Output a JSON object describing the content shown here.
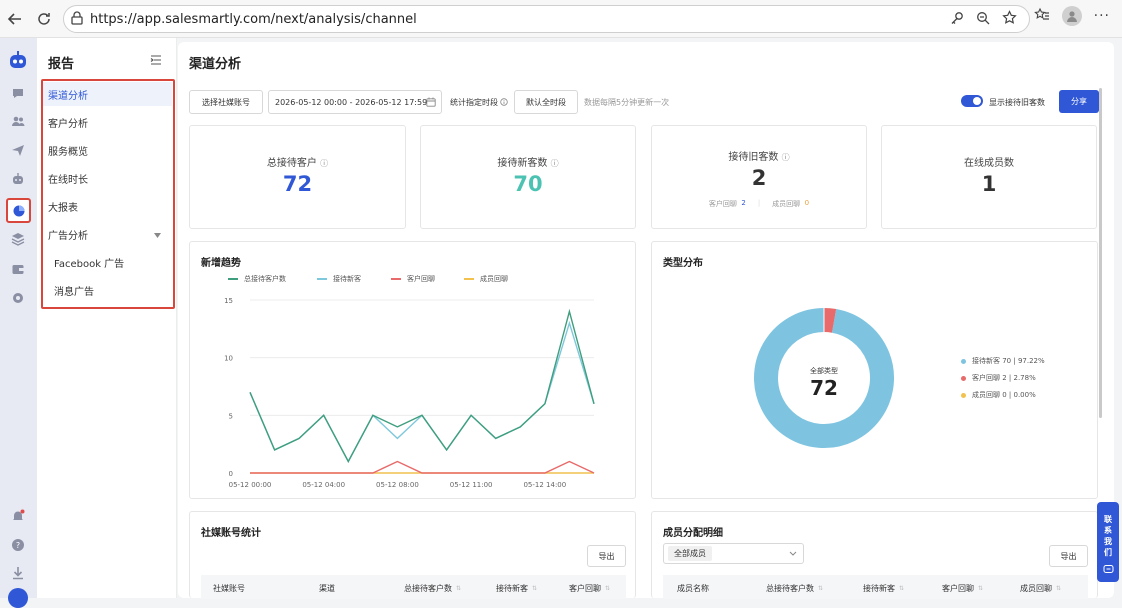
{
  "browser": {
    "url": "https://app.salesmartly.com/next/analysis/channel"
  },
  "sidebar": {
    "title": "报告",
    "items": [
      {
        "label": "渠道分析",
        "active": true
      },
      {
        "label": "客户分析"
      },
      {
        "label": "服务概览"
      },
      {
        "label": "在线时长"
      },
      {
        "label": "大报表"
      },
      {
        "label": "广告分析",
        "expandable": true
      },
      {
        "label": "Facebook 广告",
        "sub": true
      },
      {
        "label": "消息广告",
        "sub": true
      }
    ]
  },
  "toolbar": {
    "page_title": "渠道分析",
    "select_account_label": "选择社媒账号",
    "date_range": "2026-05-12 00:00 - 2026-05-12 17:59",
    "stat_period_label": "统计指定时段",
    "default_period_label": "默认全时段",
    "update_note": "数据每隔5分钟更新一次",
    "toggle_label": "显示接待旧客数",
    "share_label": "分享"
  },
  "stats": [
    {
      "label": "总接待客户",
      "value": "72",
      "color": "#2f57d6",
      "info": true
    },
    {
      "label": "接待新客数",
      "value": "70",
      "color": "#4cc2b2",
      "info": true
    },
    {
      "label": "接待旧客数",
      "value": "2",
      "color": "#333333",
      "info": true,
      "sub": [
        {
          "label": "客户回聊",
          "value": "2",
          "color": "#2f57d6"
        },
        {
          "label": "成员回聊",
          "value": "0",
          "color": "#e6a23c"
        }
      ]
    },
    {
      "label": "在线成员数",
      "value": "1",
      "color": "#333333",
      "info": false
    }
  ],
  "trend": {
    "title": "新增趋势"
  },
  "distribution": {
    "title": "类型分布",
    "center_label": "全部类型",
    "center_value": "72"
  },
  "social_stats": {
    "title": "社媒账号统计",
    "export_label": "导出",
    "columns": [
      "社媒账号",
      "渠道",
      "总接待客户数",
      "接待新客",
      "客户回聊"
    ]
  },
  "member_detail": {
    "title": "成员分配明细",
    "filter_value": "全部成员",
    "export_label": "导出",
    "columns": [
      "成员名称",
      "总接待客户数",
      "接待新客",
      "客户回聊",
      "成员回聊"
    ]
  },
  "contact_tab": {
    "chars": [
      "联",
      "系",
      "我",
      "们"
    ]
  },
  "chart_data": [
    {
      "type": "line",
      "title": "新增趋势",
      "x": [
        "05-12 00:00",
        "05-12 01:00",
        "05-12 02:00",
        "05-12 03:00",
        "05-12 04:00",
        "05-12 05:00",
        "05-12 06:00",
        "05-12 07:00",
        "05-12 08:00",
        "05-12 09:00",
        "05-12 10:00",
        "05-12 11:00",
        "05-12 12:00",
        "05-12 13:00",
        "05-12 14:00",
        "05-12 15:00",
        "05-12 16:00"
      ],
      "x_tick_labels": [
        "05-12 00:00",
        "05-12 04:00",
        "05-12 08:00",
        "05-12 11:00",
        "05-12 14:00"
      ],
      "ylim": [
        0,
        15
      ],
      "yticks": [
        0,
        5,
        10,
        15
      ],
      "series": [
        {
          "name": "总接待客户数",
          "color": "#3f9e7d",
          "values": [
            7,
            2,
            3,
            5,
            1,
            5,
            4,
            5,
            2,
            5,
            3,
            4,
            6,
            14,
            6
          ]
        },
        {
          "name": "接待新客",
          "color": "#7ec8dc",
          "values": [
            7,
            2,
            3,
            5,
            1,
            5,
            3,
            5,
            2,
            5,
            3,
            4,
            6,
            13,
            6
          ]
        },
        {
          "name": "客户回聊",
          "color": "#e86a6a",
          "values": [
            0,
            0,
            0,
            0,
            0,
            0,
            1,
            0,
            0,
            0,
            0,
            0,
            0,
            1,
            0
          ]
        },
        {
          "name": "成员回聊",
          "color": "#f2c14e",
          "values": [
            0,
            0,
            0,
            0,
            0,
            0,
            0,
            0,
            0,
            0,
            0,
            0,
            0,
            0,
            0
          ]
        }
      ],
      "legend": "top",
      "grid": true
    },
    {
      "type": "pie",
      "title": "类型分布",
      "slices": [
        {
          "name": "接待新客",
          "value": 70,
          "pct": "97.22%",
          "color": "#7ec4e0",
          "label": "接待新客 70 | 97.22%"
        },
        {
          "name": "客户回聊",
          "value": 2,
          "pct": "2.78%",
          "color": "#e86a6a",
          "label": "客户回聊 2 | 2.78%"
        },
        {
          "name": "成员回聊",
          "value": 0,
          "pct": "0.00%",
          "color": "#f2c14e",
          "label": "成员回聊 0 | 0.00%"
        }
      ],
      "legend": "right"
    }
  ]
}
